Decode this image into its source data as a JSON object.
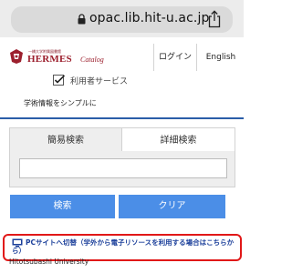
{
  "browser": {
    "url": "opac.lib.hit-u.ac.jp"
  },
  "header": {
    "logo_subtitle": "一橋大学附属図書館",
    "logo_name": "HERMES",
    "logo_catalog": "Catalog",
    "login_label": "ログイン",
    "english_label": "English",
    "user_service_label": "利用者サービス"
  },
  "tagline": "学術情報をシンプルに",
  "tabs": {
    "simple": "簡易検索",
    "detail": "詳細検索"
  },
  "search": {
    "value": "",
    "placeholder": ""
  },
  "buttons": {
    "search": "検索",
    "clear": "クリア"
  },
  "pc_link": {
    "text": "PCサイトへ切替（学外から電子リソースを利用する場合はこちらから）"
  },
  "footer": {
    "university": "Hitotsubashi University"
  },
  "colors": {
    "accent_blue": "#4b8ee7",
    "header_line": "#2a5da8",
    "logo_red": "#9c1f2d",
    "highlight_red": "#e11818",
    "link_blue": "#1b3f9a"
  }
}
